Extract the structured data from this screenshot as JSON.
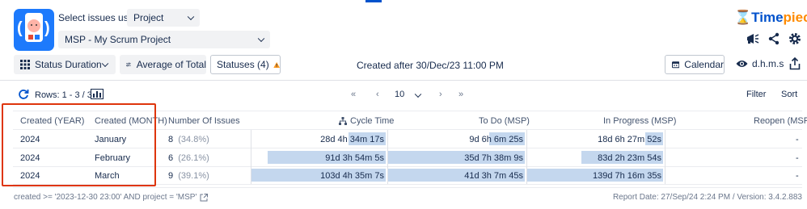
{
  "header": {
    "select_label": "Select issues using",
    "select_value": "Project",
    "project_value": "MSP - My Scrum Project",
    "logo_text_a": "Time",
    "logo_text_b": "piece",
    "logo_symbol": "⌛"
  },
  "toolbar": {
    "status_duration": "Status Duration",
    "average": "Average of Total",
    "statuses": "Statuses (4)",
    "created_filter": "Created after 30/Dec/23 11:00 PM",
    "calendar": "Calendar",
    "format": "d.h.m.s"
  },
  "rows_bar": {
    "rows_text": "Rows: 1 - 3 / 3",
    "page_size": "10",
    "filter": "Filter",
    "sort": "Sort"
  },
  "table": {
    "columns": [
      "Created (YEAR)",
      "Created (MONTH)",
      "Number Of Issues",
      "Cycle Time",
      "To Do (MSP)",
      "In Progress (MSP)",
      "Reopen (MSP)"
    ],
    "rows": [
      {
        "year": "2024",
        "month": "January",
        "count": "8",
        "pct": "(34.8%)",
        "cycle": "28d 4h 34m 17s",
        "todo": "9d 6h 6m 25s",
        "inprogress": "18d 6h 27m 52s",
        "reopen": "-",
        "cycle_frac": 0.28,
        "todo_frac": 0.26,
        "inprogress_frac": 0.13
      },
      {
        "year": "2024",
        "month": "February",
        "count": "6",
        "pct": "(26.1%)",
        "cycle": "91d 3h 54m 5s",
        "todo": "35d 7h 38m 9s",
        "inprogress": "83d 2h 23m 54s",
        "reopen": "-",
        "cycle_frac": 0.88,
        "todo_frac": 1.0,
        "inprogress_frac": 0.6
      },
      {
        "year": "2024",
        "month": "March",
        "count": "9",
        "pct": "(39.1%)",
        "cycle": "103d 4h 35m 7s",
        "todo": "41d 3h 7m 45s",
        "inprogress": "139d 7h 16m 35s",
        "reopen": "-",
        "cycle_frac": 1.0,
        "todo_frac": 1.0,
        "inprogress_frac": 1.0
      }
    ]
  },
  "footer": {
    "jql": "created >= '2023-12-30 23:00' AND project = 'MSP'",
    "report": "Report Date: 27/Sep/24 2:24 PM / Version: 3.4.2.883"
  },
  "colors": {
    "bar": "#c4d7ee",
    "highlight_box": "#de350b",
    "brand_blue": "#0052cc",
    "warning": "#ff991f"
  }
}
